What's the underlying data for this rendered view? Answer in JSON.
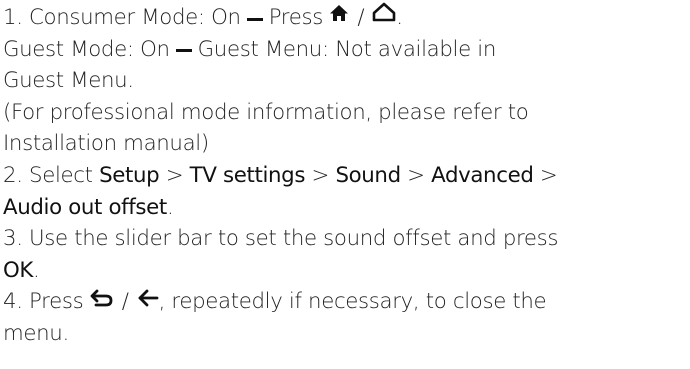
{
  "steps": {
    "s1": {
      "line1_prefix": "1. Consumer Mode: On",
      "line1_press": "Press",
      "line1_end": ".",
      "line2_prefix": "Guest Mode: On",
      "line2_rest": "Guest Menu: Not available in",
      "line3": "Guest Menu.",
      "line4": "(For professional mode information, please refer to",
      "line5": "Installation manual)",
      "icons": [
        "home-filled-icon",
        "home-outline-icon"
      ]
    },
    "s2": {
      "prefix": "2. Select",
      "setup": "Setup",
      "tv_settings": "TV settings",
      "sound": "Sound",
      "advanced": "Advanced",
      "audio_out_offset": "Audio out offset",
      "gt": ">",
      "end": "."
    },
    "s3": {
      "text": "3. Use the slider bar to set the sound offset and press",
      "ok": "OK",
      "end": "."
    },
    "s4": {
      "press": "4. Press",
      "rest": ", repeatedly if necessary, to close the",
      "line2": "menu.",
      "icons": [
        "back-arrow-icon",
        "left-arrow-icon"
      ]
    },
    "slash": "/"
  }
}
